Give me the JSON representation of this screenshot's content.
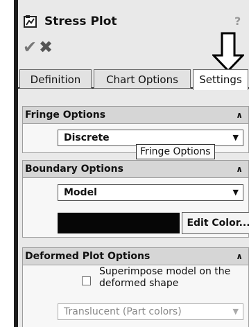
{
  "panel": {
    "title": "Stress Plot",
    "help": "?",
    "ok_glyph": "✔",
    "cancel_glyph": "✖"
  },
  "tabs": [
    {
      "label": "Definition",
      "active": false
    },
    {
      "label": "Chart Options",
      "active": false
    },
    {
      "label": "Settings",
      "active": true
    }
  ],
  "sections": {
    "fringe": {
      "title": "Fringe Options",
      "value": "Discrete",
      "tooltip": "Fringe Options"
    },
    "boundary": {
      "title": "Boundary Options",
      "value": "Model",
      "swatch_color": "#060606",
      "edit_label": "Edit Color..."
    },
    "deformed": {
      "title": "Deformed Plot Options",
      "checkbox_label": "Superimpose model on the deformed shape",
      "checked": false,
      "mode_value": "Translucent (Part colors)"
    }
  }
}
